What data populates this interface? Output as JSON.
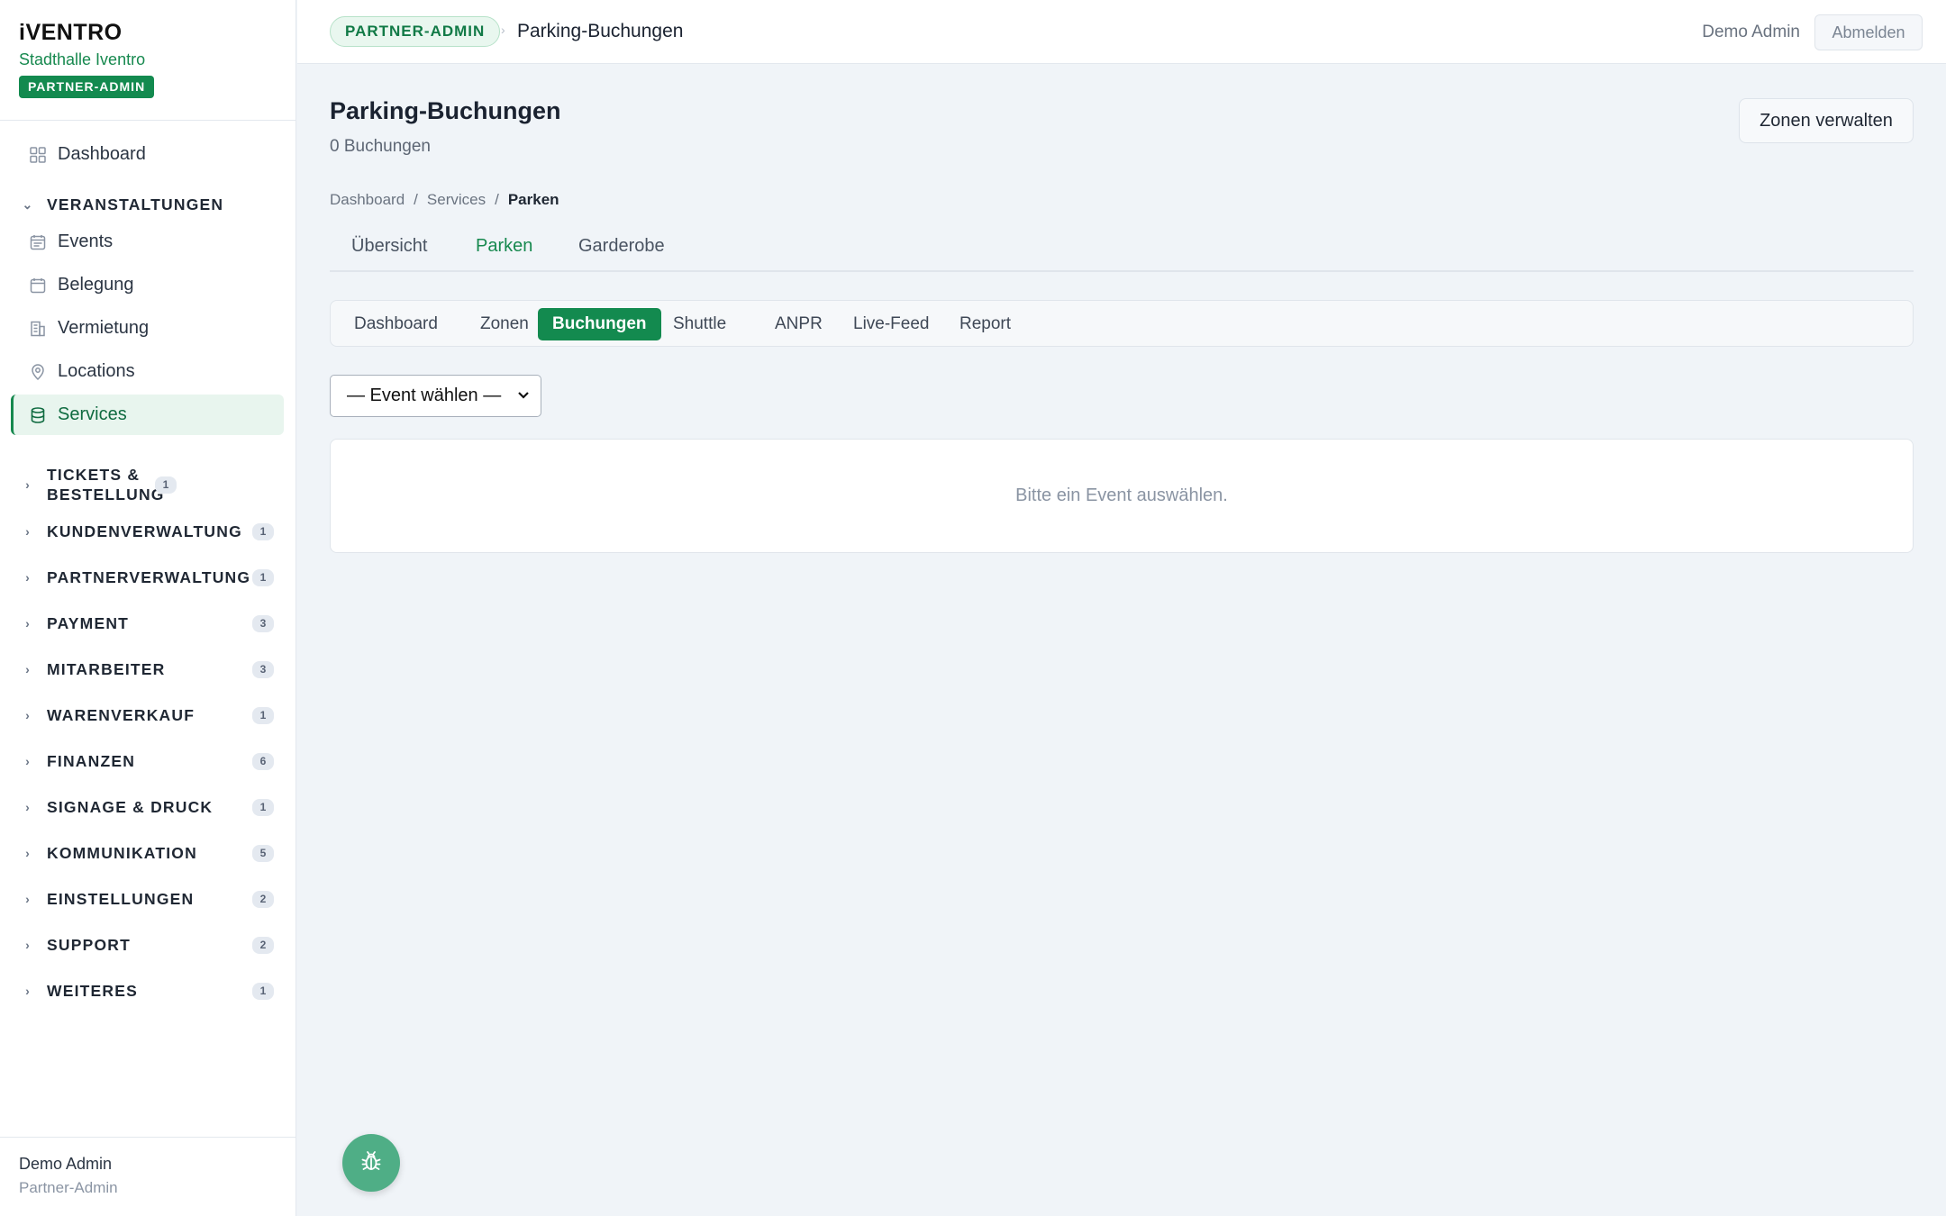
{
  "brand": {
    "logo": "iVENTRO",
    "venue": "Stadthalle Iventro",
    "role": "PARTNER-ADMIN"
  },
  "sidebar": {
    "top_items": [
      {
        "label": "Dashboard",
        "icon": "grid-icon"
      }
    ],
    "section": {
      "label": "VERANSTALTUNGEN",
      "icon": "chevron-down-icon"
    },
    "items": [
      {
        "label": "Events",
        "icon": "calendar-list-icon"
      },
      {
        "label": "Belegung",
        "icon": "calendar-icon"
      },
      {
        "label": "Vermietung",
        "icon": "building-icon"
      },
      {
        "label": "Locations",
        "icon": "map-pin-icon"
      },
      {
        "label": "Services",
        "icon": "database-icon",
        "active": true
      }
    ],
    "groups": [
      {
        "label": "TICKETS & BESTELLUNG",
        "count": "1"
      },
      {
        "label": "KUNDENVERWALTUNG",
        "count": "1"
      },
      {
        "label": "PARTNERVERWALTUNG",
        "count": "1"
      },
      {
        "label": "PAYMENT",
        "count": "3"
      },
      {
        "label": "MITARBEITER",
        "count": "3"
      },
      {
        "label": "WARENVERKAUF",
        "count": "1"
      },
      {
        "label": "FINANZEN",
        "count": "6"
      },
      {
        "label": "SIGNAGE & DRUCK",
        "count": "1"
      },
      {
        "label": "KOMMUNIKATION",
        "count": "5"
      },
      {
        "label": "EINSTELLUNGEN",
        "count": "2"
      },
      {
        "label": "SUPPORT",
        "count": "2"
      },
      {
        "label": "WEITERES",
        "count": "1"
      }
    ],
    "footer": {
      "name": "Demo Admin",
      "role": "Partner-Admin"
    }
  },
  "topbar": {
    "badge": "PARTNER-ADMIN",
    "separator": "›",
    "title": "Parking-Buchungen",
    "user": "Demo Admin",
    "logout": "Abmelden"
  },
  "main": {
    "title": "Parking-Buchungen",
    "subtitle": "0 Buchungen",
    "zones_button": "Zonen verwalten",
    "breadcrumb": {
      "items": [
        "Dashboard",
        "Services"
      ],
      "separator": "/",
      "current": "Parken"
    },
    "tabs": [
      {
        "label": "Übersicht"
      },
      {
        "label": "Parken",
        "active": true
      },
      {
        "label": "Garderobe"
      }
    ],
    "subtabs": [
      {
        "label": "Dashboard"
      },
      {
        "label": "Zonen"
      },
      {
        "label": "Buchungen",
        "active": true
      },
      {
        "label": "Shuttle"
      },
      {
        "label": "ANPR"
      },
      {
        "label": "Live-Feed"
      },
      {
        "label": "Report"
      }
    ],
    "event_select": {
      "value": "— Event wählen —"
    },
    "empty_message": "Bitte ein Event auswählen."
  },
  "colors": {
    "accent": "#138a4f",
    "active_bg": "#e8f5ee",
    "fab": "#4fae86"
  },
  "fab_icon": "bug-icon"
}
